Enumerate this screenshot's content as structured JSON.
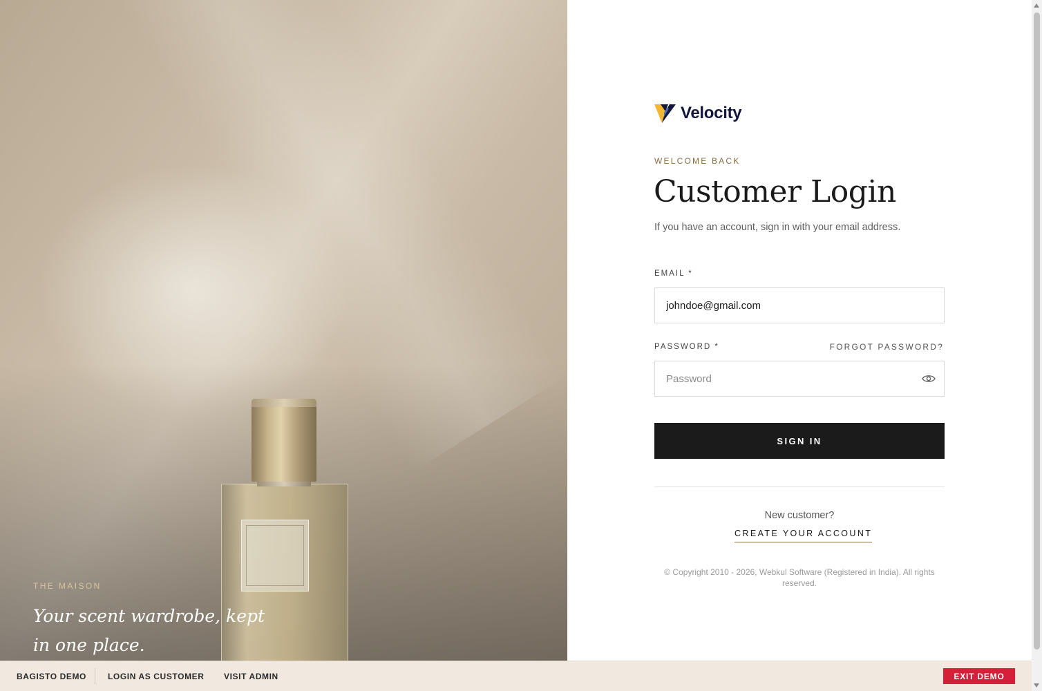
{
  "hero": {
    "kicker": "THE MAISON",
    "tagline": "Your scent wardrobe, kept in one place."
  },
  "brand": {
    "name": "Velocity",
    "colors": {
      "navy": "#14163a",
      "gold": "#f2b632",
      "accent": "#8a6d45"
    }
  },
  "login": {
    "kicker": "WELCOME BACK",
    "title": "Customer Login",
    "subtitle": "If you have an account, sign in with your email address.",
    "email_label": "EMAIL *",
    "email_value": "johndoe@gmail.com",
    "password_label": "PASSWORD *",
    "password_placeholder": "Password",
    "forgot_label": "FORGOT PASSWORD?",
    "signin_label": "SIGN IN",
    "new_customer": "New customer?",
    "create_account": "CREATE YOUR ACCOUNT",
    "copyright": "© Copyright 2010 - 2026, Webkul Software (Registered in India). All rights reserved."
  },
  "demobar": {
    "items": [
      "BAGISTO DEMO",
      "LOGIN AS CUSTOMER",
      "VISIT ADMIN"
    ],
    "exit_label": "EXIT DEMO",
    "exit_color": "#d6203a"
  },
  "icons": {
    "logo": "velocity-v-logo-icon",
    "password_toggle": "eye-icon"
  }
}
